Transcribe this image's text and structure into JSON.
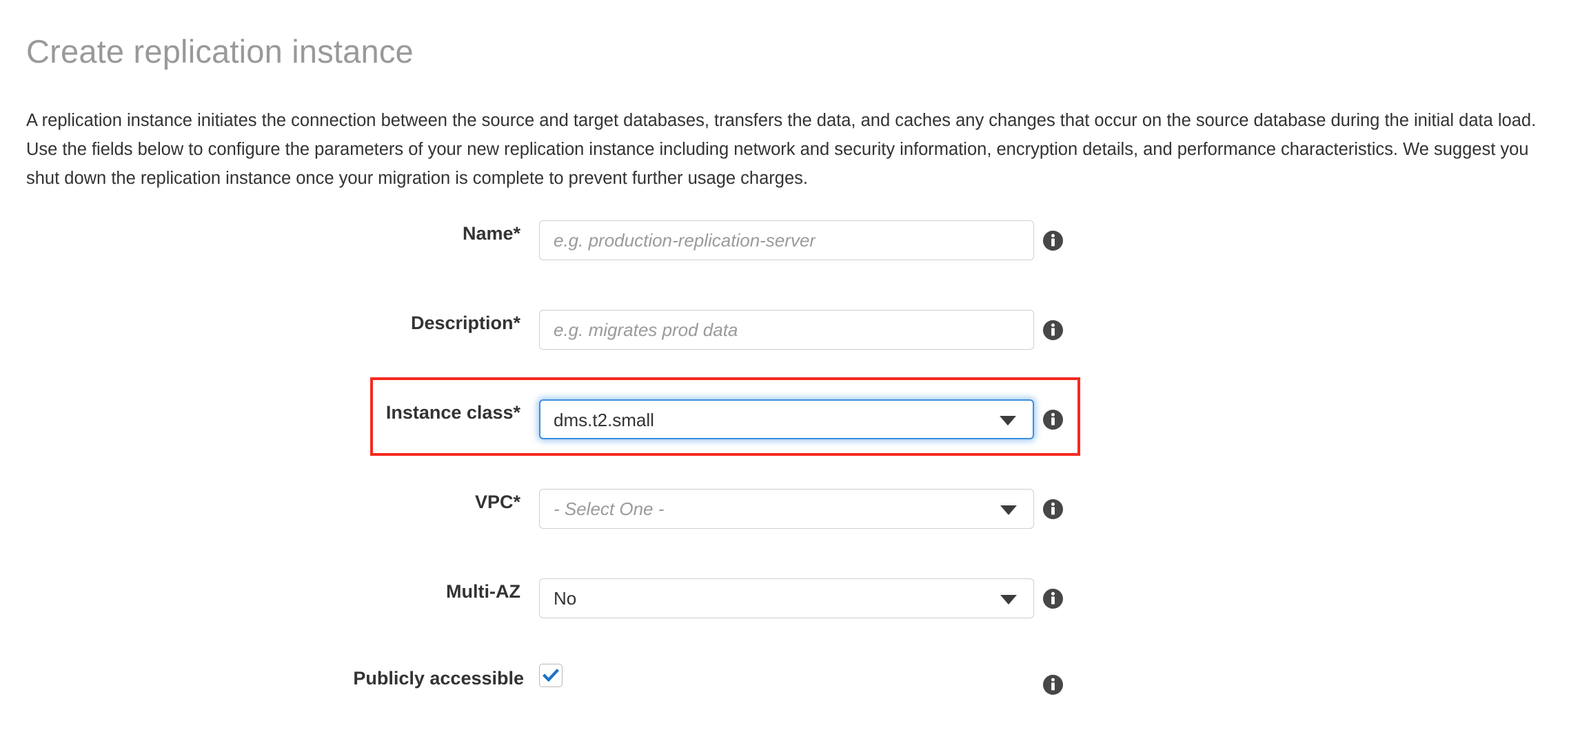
{
  "header": {
    "title": "Create replication instance",
    "intro": "A replication instance initiates the connection between the source and target databases, transfers the data, and caches any changes that occur on the source database during the initial data load. Use the fields below to configure the parameters of your new replication instance including network and security information, encryption details, and performance characteristics. We suggest you shut down the replication instance once your migration is complete to prevent further usage charges."
  },
  "form": {
    "name": {
      "label": "Name*",
      "placeholder": "e.g. production-replication-server",
      "value": "",
      "info_icon": "info-icon"
    },
    "description": {
      "label": "Description*",
      "placeholder": "e.g. migrates prod data",
      "value": "",
      "info_icon": "info-icon"
    },
    "instance_class": {
      "label": "Instance class*",
      "value": "dms.t2.small",
      "caret_icon": "chevron-down-icon",
      "info_icon": "info-icon"
    },
    "vpc": {
      "label": "VPC*",
      "value": "- Select One -",
      "caret_icon": "chevron-down-icon",
      "info_icon": "info-icon"
    },
    "multi_az": {
      "label": "Multi-AZ",
      "value": "No",
      "caret_icon": "chevron-down-icon",
      "info_icon": "info-icon"
    },
    "publicly_accessible": {
      "label": "Publicly accessible",
      "checked": true,
      "check_icon": "check-icon",
      "info_icon": "info-icon"
    }
  },
  "annotation": {
    "highlight_color": "#f5291f",
    "focus_color": "#3b8fe0"
  }
}
